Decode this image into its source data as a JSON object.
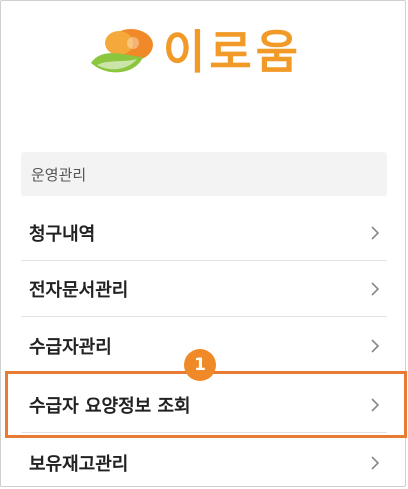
{
  "app": {
    "logo_text": "이로움",
    "brand_color": "#f19a27"
  },
  "menu": {
    "section_label": "운영관리",
    "items": [
      {
        "label": "청구내역",
        "icon": "chevron-right-icon"
      },
      {
        "label": "전자문서관리",
        "icon": "chevron-right-icon"
      },
      {
        "label": "수급자관리",
        "icon": "chevron-right-icon"
      },
      {
        "label": "수급자 요양정보 조회",
        "icon": "chevron-right-icon"
      },
      {
        "label": "보유재고관리",
        "icon": "chevron-right-icon"
      }
    ]
  },
  "annotation": {
    "step_badge": "1",
    "highlight_color": "#e87a32"
  }
}
